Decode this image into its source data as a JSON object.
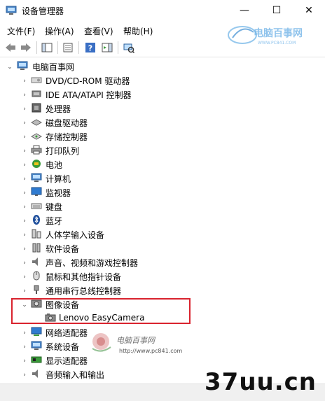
{
  "window": {
    "title": "设备管理器",
    "minimize_glyph": "—",
    "maximize_glyph": "☐",
    "close_glyph": "✕"
  },
  "menu": [
    "文件(F)",
    "操作(A)",
    "查看(V)",
    "帮助(H)"
  ],
  "watermark": {
    "logo_text": "电脑百事网",
    "logo_url": "WWW.PC841.COM",
    "rose_text": "电脑百事网",
    "rose_url": "http://www.pc841.com",
    "site": "37uu.cn"
  },
  "tree": {
    "root": "电脑百事网",
    "nodes": [
      {
        "label": "DVD/CD-ROM 驱动器",
        "icon": "dvd-drive-icon"
      },
      {
        "label": "IDE ATA/ATAPI 控制器",
        "icon": "ide-controller-icon"
      },
      {
        "label": "处理器",
        "icon": "processor-icon"
      },
      {
        "label": "磁盘驱动器",
        "icon": "disk-drive-icon"
      },
      {
        "label": "存储控制器",
        "icon": "storage-controller-icon"
      },
      {
        "label": "打印队列",
        "icon": "printer-icon"
      },
      {
        "label": "电池",
        "icon": "battery-icon"
      },
      {
        "label": "计算机",
        "icon": "computer-icon"
      },
      {
        "label": "监视器",
        "icon": "monitor-icon"
      },
      {
        "label": "键盘",
        "icon": "keyboard-icon"
      },
      {
        "label": "蓝牙",
        "icon": "bluetooth-icon"
      },
      {
        "label": "人体学输入设备",
        "icon": "hid-icon"
      },
      {
        "label": "软件设备",
        "icon": "software-device-icon"
      },
      {
        "label": "声音、视频和游戏控制器",
        "icon": "sound-icon"
      },
      {
        "label": "鼠标和其他指针设备",
        "icon": "mouse-icon"
      },
      {
        "label": "通用串行总线控制器",
        "icon": "usb-icon"
      },
      {
        "label": "图像设备",
        "icon": "imaging-device-icon",
        "expanded": true
      },
      {
        "label": "Lenovo EasyCamera",
        "icon": "camera-icon",
        "child": true
      },
      {
        "label": "网络适配器",
        "icon": "network-adapter-icon"
      },
      {
        "label": "系统设备",
        "icon": "system-device-icon"
      },
      {
        "label": "显示适配器",
        "icon": "display-adapter-icon"
      },
      {
        "label": "音频输入和输出",
        "icon": "audio-io-icon"
      }
    ]
  },
  "colors": {
    "highlight_border": "#d9232e",
    "selection": "#cce8ff"
  }
}
